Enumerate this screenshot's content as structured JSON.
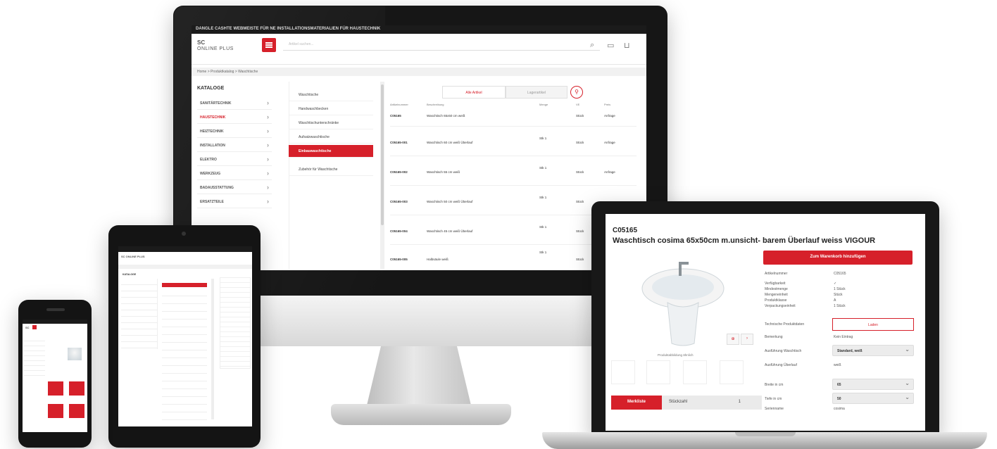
{
  "colors": {
    "brand_red": "#d6202a",
    "bezel": "#161616",
    "panel_grey": "#f1f1f1"
  },
  "desktop": {
    "topbar_text": "DANGLE CASHTE WEBMEISTE FÜR NE INSTALLATIONSMATERIALIEN FÜR HAUSTECHNIK",
    "logo_top": "SC",
    "logo_bottom": "ONLINE PLUS",
    "search_placeholder": "Artikel suchen...",
    "breadcrumb": "Home  >  Produktkatalog  >  Waschtische",
    "sidebar_title": "KATALOGE",
    "sidebar_items": [
      {
        "label": "SANITÄRTECHNIK"
      },
      {
        "label": "HAUSTECHNIK"
      },
      {
        "label": "HEIZTECHNIK"
      },
      {
        "label": "INSTALLATION"
      },
      {
        "label": "ELEKTRO"
      },
      {
        "label": "WERKZEUG"
      },
      {
        "label": "BADAUSSTATTUNG"
      },
      {
        "label": "ERSATZTEILE"
      }
    ],
    "categories": [
      {
        "label": "Waschtische"
      },
      {
        "label": "Handwaschbecken"
      },
      {
        "label": "Waschtischunterschränke"
      },
      {
        "label": "Aufsatzwaschtische"
      },
      {
        "label": "Einbauwaschtische"
      },
      {
        "label": "Zubehör für Waschtische"
      }
    ],
    "seg_left": "Alle Artikel",
    "seg_right": "Lagerartikel",
    "table_headers": [
      "Artikelnummer",
      "Beschreibung",
      "Menge",
      "VE",
      "Preis"
    ],
    "rows": [
      {
        "num": "C05165",
        "desc": "Waschtisch 65x50 cm weiß",
        "qty": "",
        "ve": "Stück",
        "price": "Anfrage"
      },
      {
        "num": "C05165-001",
        "desc": "Waschtisch 60 cm weiß Überlauf",
        "qty": "Stk 1",
        "ve": "Stück",
        "price": "Anfrage"
      },
      {
        "num": "C05165-002",
        "desc": "Waschtisch 55 cm weiß",
        "qty": "Stk 1",
        "ve": "Stück",
        "price": "Anfrage"
      },
      {
        "num": "C05165-003",
        "desc": "Waschtisch 50 cm weiß Überlauf",
        "qty": "Stk 1",
        "ve": "Stück",
        "price": ""
      },
      {
        "num": "C05165-004",
        "desc": "Waschtisch 45 cm weiß Überlauf",
        "qty": "Stk 1",
        "ve": "Stück",
        "price": ""
      },
      {
        "num": "C05165-005",
        "desc": "Halbsäule weiß",
        "qty": "Stk 1",
        "ve": "Stück",
        "price": ""
      }
    ]
  },
  "laptop": {
    "product_code": "C05165",
    "product_title": "Waschtisch cosima 65x50cm m.unsicht- barem Überlauf weiss VIGOUR",
    "cart_button": "Zum Warenkorb hinzufügen",
    "image_caption": "Produktabbildung ähnlich",
    "specs": [
      {
        "label": "Artikelnummer",
        "value": "C05165"
      },
      {
        "label": "Verfügbarkeit",
        "value": "✓"
      },
      {
        "label": "Mindestmenge",
        "value": "1 Stück"
      },
      {
        "label": "Mengeneinheit",
        "value": "Stück"
      },
      {
        "label": "Produktklasse",
        "value": "A"
      },
      {
        "label": "Verpackungseinheit",
        "value": "1 Stück"
      }
    ],
    "product_data_label": "Technische Produktdaten",
    "product_data_button": "Laden",
    "notes_label": "Bemerkung",
    "notes_value": "Kein Eintrag",
    "select_rows": [
      {
        "label": "Ausführung Waschtisch",
        "value": "Standard, weiß"
      },
      {
        "label": "Ausführung Überlauf",
        "value": "weiß"
      },
      {
        "label": "Breite in cm",
        "value": "65"
      },
      {
        "label": "Tiefe in cm",
        "value": "50"
      }
    ],
    "series_label": "Serienname",
    "series_value": "cosima",
    "add_button": "Merkliste",
    "qty_label": "Stückzahl",
    "qty_value": "1"
  },
  "tablet": {
    "header": "SC ONLINE PLUS",
    "title": "KATALOGE"
  },
  "phone": {
    "header": "SC"
  }
}
